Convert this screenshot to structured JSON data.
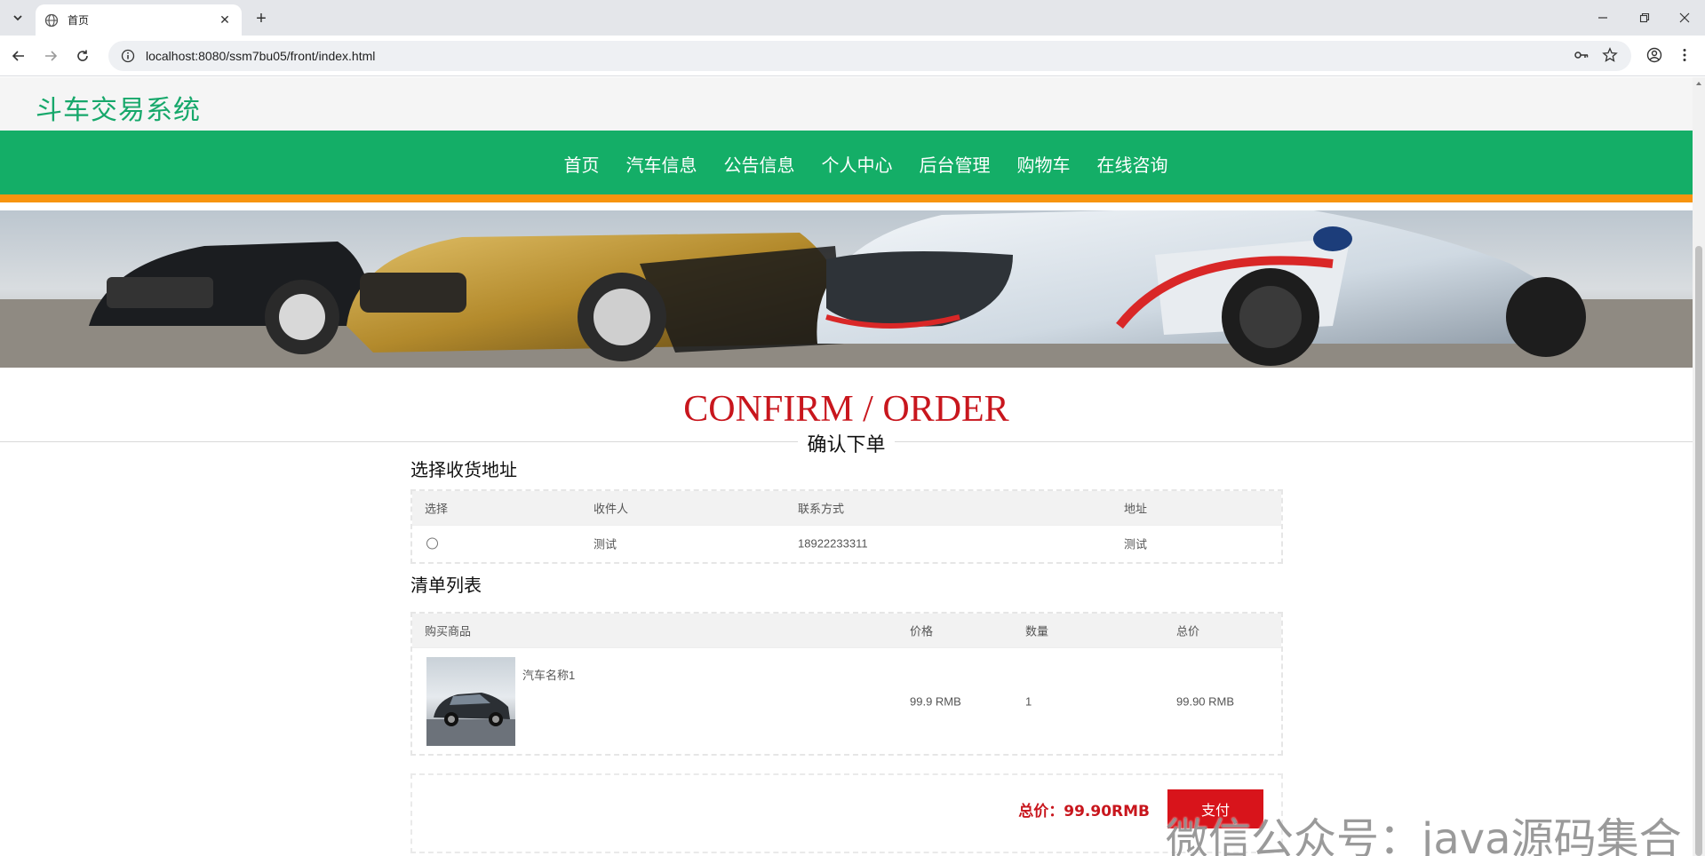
{
  "browser": {
    "tab_title": "首页",
    "url": "localhost:8080/ssm7bu05/front/index.html"
  },
  "site": {
    "logo": "斗车交易系统",
    "nav": [
      "首页",
      "汽车信息",
      "公告信息",
      "个人中心",
      "后台管理",
      "购物车",
      "在线咨询"
    ]
  },
  "page": {
    "title_en": "CONFIRM / ORDER",
    "title_cn": "确认下单"
  },
  "address_section": {
    "title": "选择收货地址",
    "headers": [
      "选择",
      "收件人",
      "联系方式",
      "地址"
    ],
    "rows": [
      {
        "recipient": "测试",
        "phone": "18922233311",
        "address": "测试"
      }
    ]
  },
  "order_section": {
    "title": "清单列表",
    "headers": [
      "购买商品",
      "价格",
      "数量",
      "总价"
    ],
    "items": [
      {
        "name": "汽车名称1",
        "price": "99.9 RMB",
        "quantity": "1",
        "total": "99.90 RMB"
      }
    ]
  },
  "summary": {
    "total_label": "总价：99.90RMB",
    "pay_label": "支付"
  },
  "watermark": "微信公众号：java源码集合",
  "colors": {
    "brand_green": "#14ae67",
    "accent_orange": "#f7940f",
    "title_red": "#c8161d"
  }
}
